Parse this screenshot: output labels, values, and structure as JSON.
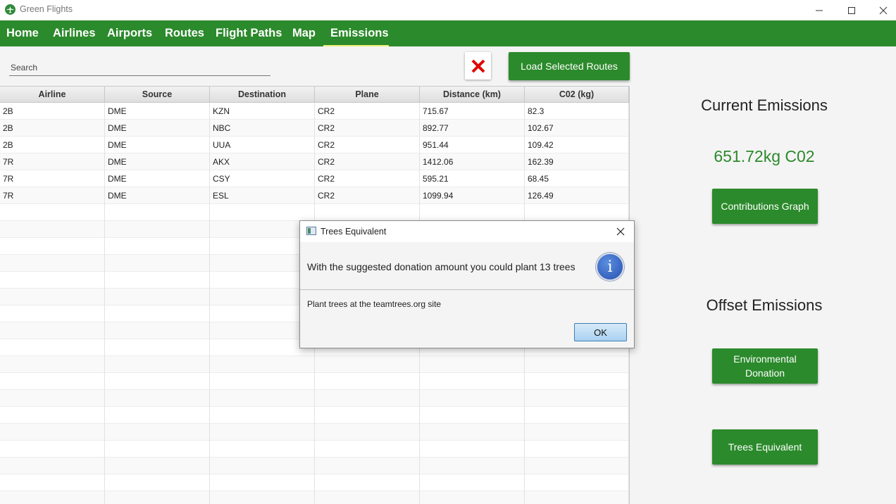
{
  "window": {
    "title": "Green Flights"
  },
  "nav": {
    "items": [
      "Home",
      "Airlines",
      "Airports",
      "Routes",
      "Flight Paths",
      "Map",
      "Emissions"
    ],
    "active": "Emissions"
  },
  "search": {
    "placeholder": "Search",
    "value": ""
  },
  "toolbar": {
    "load_label": "Load Selected Routes"
  },
  "table": {
    "columns": [
      "Airline",
      "Source",
      "Destination",
      "Plane",
      "Distance (km)",
      "C02 (kg)"
    ],
    "rows": [
      [
        "2B",
        "DME",
        "KZN",
        "CR2",
        "715.67",
        "82.3"
      ],
      [
        "2B",
        "DME",
        "NBC",
        "CR2",
        "892.77",
        "102.67"
      ],
      [
        "2B",
        "DME",
        "UUA",
        "CR2",
        "951.44",
        "109.42"
      ],
      [
        "7R",
        "DME",
        "AKX",
        "CR2",
        "1412.06",
        "162.39"
      ],
      [
        "7R",
        "DME",
        "CSY",
        "CR2",
        "595.21",
        "68.45"
      ],
      [
        "7R",
        "DME",
        "ESL",
        "CR2",
        "1099.94",
        "126.49"
      ]
    ]
  },
  "panel": {
    "current_heading": "Current Emissions",
    "emissions_value": "651.72kg C02",
    "contributions_label": "Contributions Graph",
    "offset_heading": "Offset Emissions",
    "donation_label": "Environmental Donation",
    "trees_label": "Trees Equivalent"
  },
  "dialog": {
    "title": "Trees Equivalent",
    "header": "With the suggested donation amount you could plant 13 trees",
    "content": "Plant trees at the teamtrees.org site",
    "ok_label": "OK",
    "icon": "info-icon"
  },
  "colors": {
    "brand_green": "#2b8a2b",
    "nav_active_underline": "#f2f07a",
    "clear_icon_red": "#e00000"
  }
}
